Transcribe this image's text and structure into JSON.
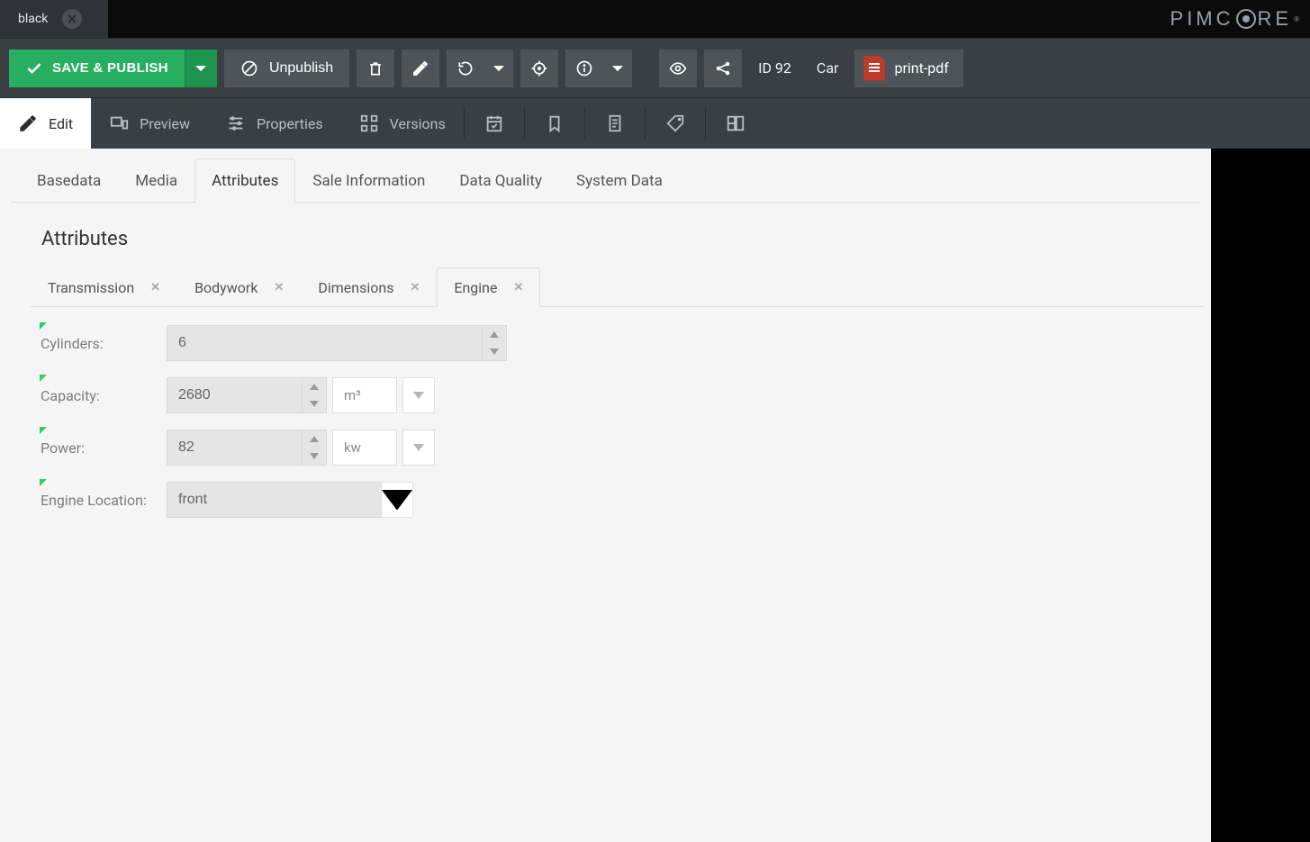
{
  "documentTab": {
    "title": "black"
  },
  "brand": "PIMCORE",
  "toolbar": {
    "save_label": "SAVE & PUBLISH",
    "unpublish_label": "Unpublish",
    "id_label": "ID 92",
    "class_label": "Car",
    "pdf_label": "print-pdf"
  },
  "subbar": {
    "edit": "Edit",
    "preview": "Preview",
    "properties": "Properties",
    "versions": "Versions"
  },
  "primaryTabs": {
    "basedata": "Basedata",
    "media": "Media",
    "attributes": "Attributes",
    "sale": "Sale Information",
    "quality": "Data Quality",
    "system": "System Data",
    "active": "attributes"
  },
  "sectionTitle": "Attributes",
  "attributeTabs": {
    "transmission": "Transmission",
    "bodywork": "Bodywork",
    "dimensions": "Dimensions",
    "engine": "Engine",
    "active": "engine"
  },
  "fields": {
    "cylinders": {
      "label": "Cylinders:",
      "value": "6"
    },
    "capacity": {
      "label": "Capacity:",
      "value": "2680",
      "unit": "m³"
    },
    "power": {
      "label": "Power:",
      "value": "82",
      "unit": "kw"
    },
    "engineLocation": {
      "label": "Engine Location:",
      "value": "front"
    }
  }
}
